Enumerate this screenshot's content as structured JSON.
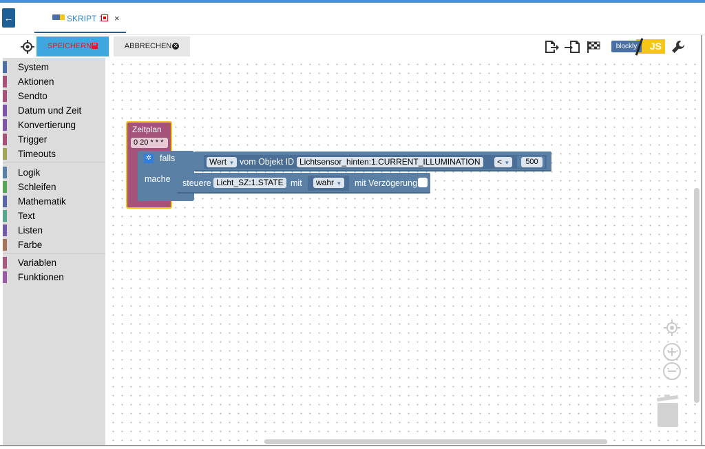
{
  "tab": {
    "label": "SKRIPT 1",
    "close": "×"
  },
  "toolbar": {
    "save_label": "SPEICHERN",
    "cancel_label": "ABBRECHEN",
    "blockly_label": "blockly",
    "js_label": "JS",
    "icons": [
      "crosshair-icon",
      "export-icon",
      "import-icon",
      "checkered-flag-icon",
      "wrench-icon"
    ]
  },
  "sidebar": {
    "groups": [
      {
        "items": [
          {
            "label": "System",
            "color": "#4c6ea2"
          },
          {
            "label": "Aktionen",
            "color": "#a5537a"
          },
          {
            "label": "Sendto",
            "color": "#a5537a"
          },
          {
            "label": "Datum und Zeit",
            "color": "#8155a5"
          },
          {
            "label": "Konvertierung",
            "color": "#8155a5"
          },
          {
            "label": "Trigger",
            "color": "#a5537a"
          },
          {
            "label": "Timeouts",
            "color": "#9fa55b"
          }
        ]
      },
      {
        "items": [
          {
            "label": "Logik",
            "color": "#5b80a5"
          },
          {
            "label": "Schleifen",
            "color": "#5ba55b"
          },
          {
            "label": "Mathematik",
            "color": "#5b67a5"
          },
          {
            "label": "Text",
            "color": "#5ba58c"
          },
          {
            "label": "Listen",
            "color": "#745ba5"
          },
          {
            "label": "Farbe",
            "color": "#a5745b"
          }
        ]
      },
      {
        "items": [
          {
            "label": "Variablen",
            "color": "#a55b80"
          },
          {
            "label": "Funktionen",
            "color": "#995ba5"
          }
        ]
      }
    ]
  },
  "blocks": {
    "schedule": {
      "title": "Zeitplan",
      "cron": "0 20 * * *"
    },
    "if": {
      "falls": "falls",
      "mache": "mache"
    },
    "condition": {
      "value_dropdown": "Wert",
      "text_from_object": "vom Objekt ID",
      "object_id": "Lichtsensor_hinten:1.CURRENT_ILLUMINATION",
      "operator": "<",
      "number": "500"
    },
    "control": {
      "steuere": "steuere",
      "object_id": "Licht_SZ:1.STATE",
      "mit": "mit",
      "value": "wahr",
      "delay_label": "mit Verzögerung"
    }
  },
  "workspace_icons": [
    "center-icon",
    "zoom-in-icon",
    "zoom-out-icon",
    "trash-icon"
  ]
}
